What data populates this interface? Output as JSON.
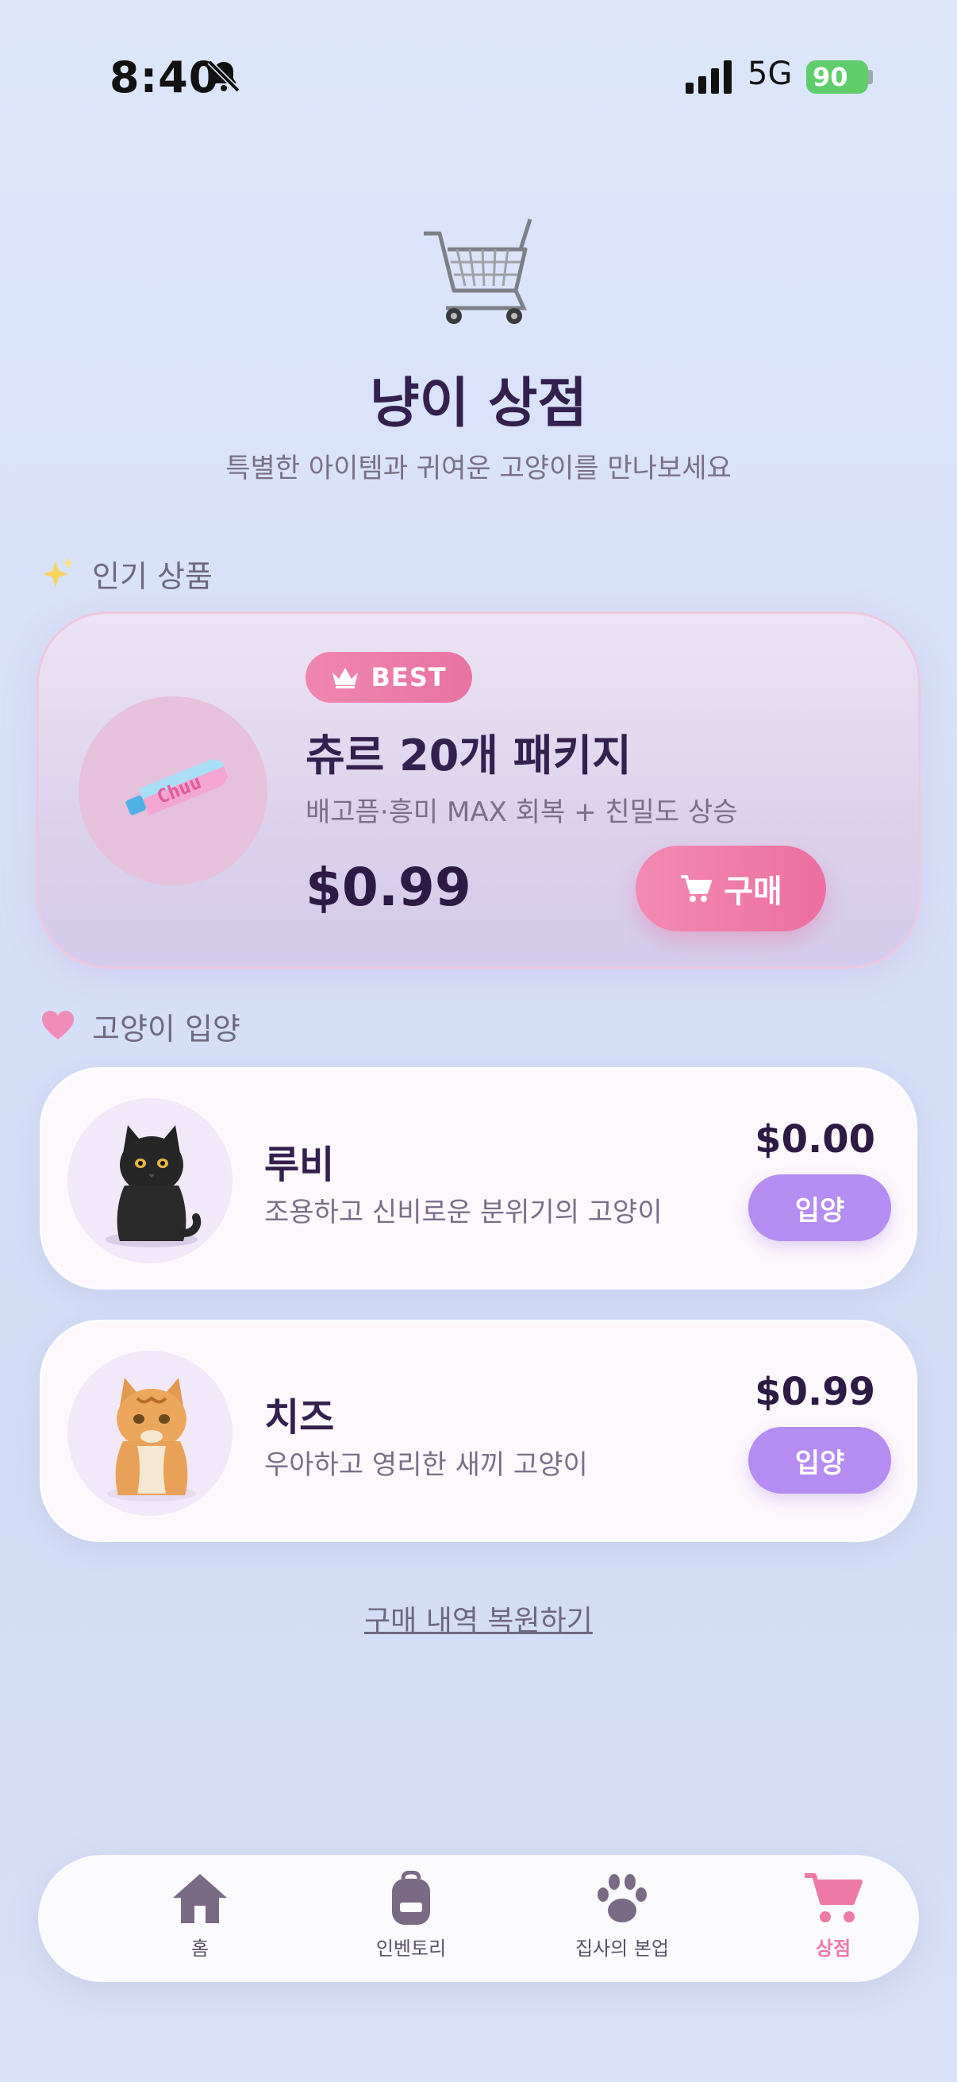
{
  "status_bar": {
    "time": "8:40",
    "network": "5G",
    "battery": "90"
  },
  "header": {
    "title": "냥이 상점",
    "subtitle": "특별한 아이템과 귀여운 고양이를 만나보세요"
  },
  "popular_section": {
    "label": "인기 상품"
  },
  "featured": {
    "badge": "BEST",
    "name": "츄르 20개 패키지",
    "description": "배고픔·흥미 MAX 회복 + 친밀도 상승",
    "price": "$0.99",
    "buy_label": "구매",
    "image_text": "Chuu"
  },
  "adopt_section": {
    "label": "고양이 입양"
  },
  "cats": [
    {
      "name": "루비",
      "description": "조용하고 신비로운 분위기의 고양이",
      "price": "$0.00",
      "adopt_label": "입양"
    },
    {
      "name": "치즈",
      "description": "우아하고 영리한 새끼 고양이",
      "price": "$0.99",
      "adopt_label": "입양"
    }
  ],
  "restore_label": "구매 내역 복원하기",
  "tabs": [
    {
      "label": "홈",
      "icon": "home-icon"
    },
    {
      "label": "인벤토리",
      "icon": "backpack-icon"
    },
    {
      "label": "집사의 본업",
      "icon": "paw-icon"
    },
    {
      "label": "상점",
      "icon": "cart-icon",
      "active": true
    }
  ],
  "colors": {
    "accent_pink": "#ee79a6",
    "adopt_purple": "#b48cf2",
    "title_text": "#34204f"
  }
}
